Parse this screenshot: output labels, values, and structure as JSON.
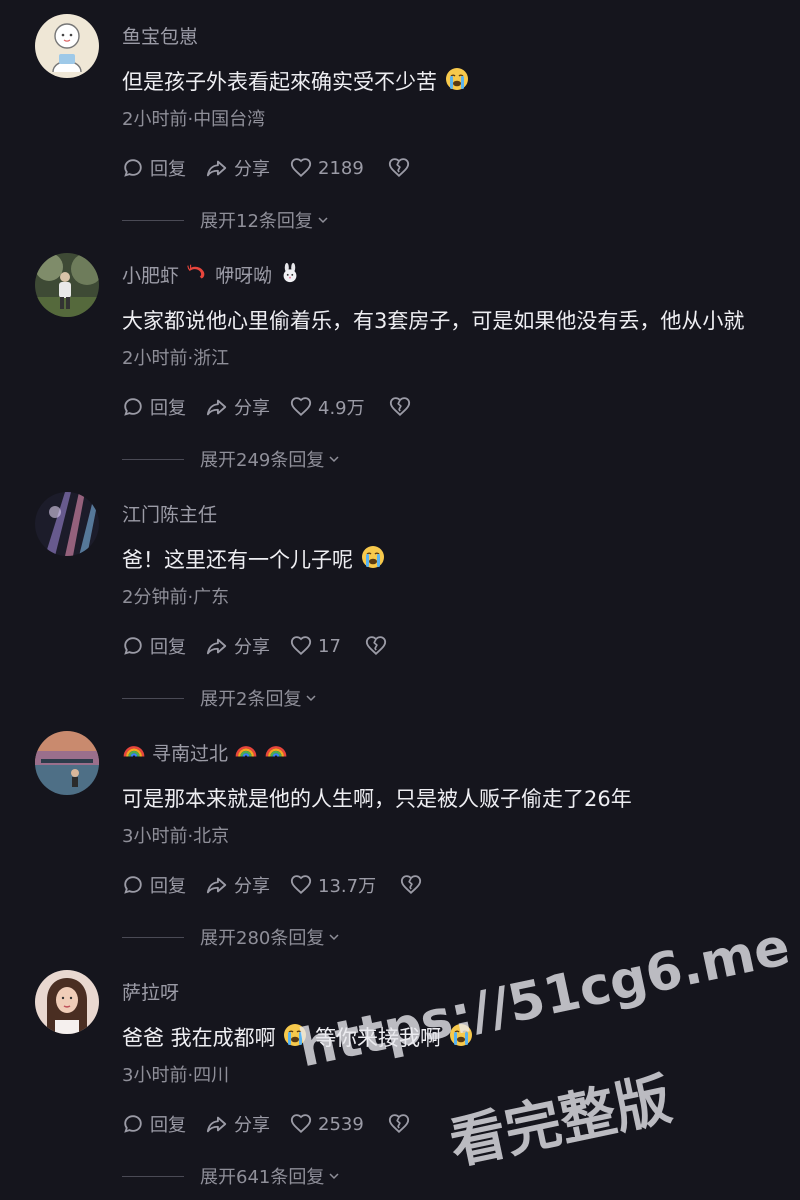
{
  "action_labels": {
    "reply": "回复",
    "share": "分享"
  },
  "colors": {
    "background": "#15151d",
    "text": "#eeeef2",
    "muted": "#8f8f99"
  },
  "comments": [
    {
      "username": "鱼宝包崽",
      "username_emojis": [],
      "text": "但是孩子外表看起來确实受不少苦",
      "text_emoji": "loudly-crying-emoji",
      "meta": "2小时前·中国台湾",
      "likes": "2189",
      "expand": "展开12条回复"
    },
    {
      "username": "小肥虾",
      "username_suffix": "咿呀呦",
      "username_emojis": [
        "shrimp-emoji",
        "rabbit-emoji"
      ],
      "text": "大家都说他心里偷着乐，有3套房子，可是如果他没有丢，他从小就",
      "meta": "2小时前·浙江",
      "likes": "4.9万",
      "expand": "展开249条回复"
    },
    {
      "username": "江门陈主任",
      "username_emojis": [],
      "text": "爸！这里还有一个儿子呢",
      "text_emoji": "loudly-crying-emoji",
      "meta": "2分钟前·广东",
      "likes": "17",
      "expand": "展开2条回复"
    },
    {
      "username": "寻南过北",
      "username_emojis": [
        "rainbow-emoji",
        "rainbow-emoji",
        "rainbow-emoji"
      ],
      "text": "可是那本来就是他的人生啊，只是被人贩子偷走了26年",
      "meta": "3小时前·北京",
      "likes": "13.7万",
      "expand": "展开280条回复"
    },
    {
      "username": "萨拉呀",
      "username_emojis": [],
      "text_part1": "爸爸 我在成都啊",
      "text_part2": "等你来接我啊",
      "text_emoji": "loudly-crying-emoji",
      "meta": "3小时前·四川",
      "likes": "2539",
      "expand": "展开641条回复"
    }
  ],
  "watermark": {
    "line1": "https://51cg6.me",
    "line2": "看完整版"
  }
}
